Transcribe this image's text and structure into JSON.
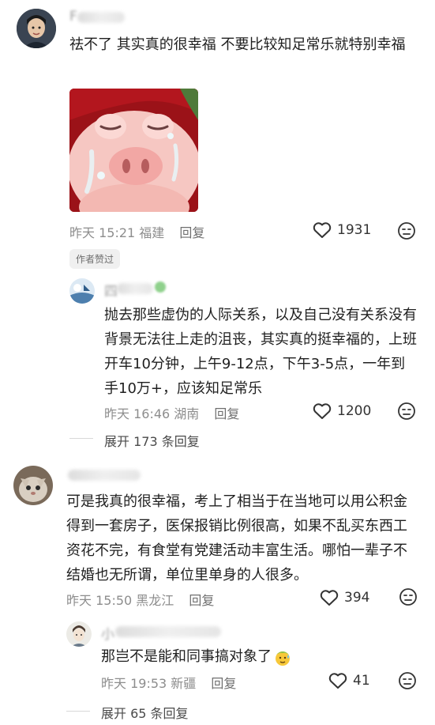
{
  "comments": [
    {
      "text": "祛不了 其实真的很幸福 不要比较知足常乐就特别幸福",
      "date": "昨天 15:21",
      "location": "福建",
      "reply_label": "回复",
      "likes": "1931",
      "author_liked_badge": "作者赞过",
      "replies": [
        {
          "text": "抛去那些虚伪的人际关系，以及自己没有关系没有背景无法往上走的沮丧，其实真的挺幸福的，上班开车10分钟，上午9-12点，下午3-5点，一年到手10万+，应该知足常乐",
          "date": "昨天 16:46",
          "location": "湖南",
          "reply_label": "回复",
          "likes": "1200"
        }
      ],
      "expand_label": "展开 173 条回复"
    },
    {
      "text": "可是我真的很幸福，考上了相当于在当地可以用公积金得到一套房子，医保报销比例很高，如果不乱买东西工资花不完，有食堂有党建活动丰富生活。哪怕一辈子不结婚也无所谓，单位里单身的人很多。",
      "date": "昨天 15:50",
      "location": "黑龙江",
      "reply_label": "回复",
      "likes": "394",
      "replies": [
        {
          "text": "那岂不是能和同事搞对象了",
          "date": "昨天 19:53",
          "location": "新疆",
          "reply_label": "回复",
          "likes": "41"
        }
      ],
      "expand_label": "展开 65 条回复"
    }
  ],
  "icons": [
    "heart-outline-icon",
    "dislike-face-icon",
    "pig-sticker",
    "sweat-emoji-icon"
  ]
}
